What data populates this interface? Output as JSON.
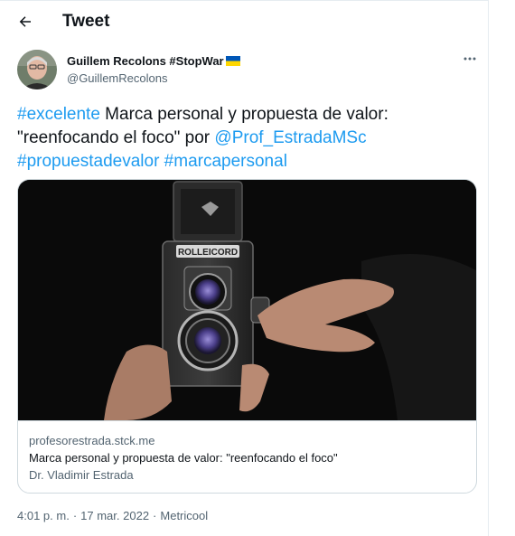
{
  "header": {
    "title": "Tweet"
  },
  "author": {
    "name": "Guillem Recolons #StopWar",
    "handle": "@GuillemRecolons"
  },
  "tweet": {
    "hashtag_1": "#excelente",
    "text_1": " Marca personal y propuesta de valor: \"reenfocando el foco\" por ",
    "mention": "@Prof_EstradaMSc",
    "hashtag_2": "#propuestadevalor",
    "hashtag_3": "#marcapersonal"
  },
  "card": {
    "domain": "profesorestrada.stck.me",
    "title": "Marca personal y propuesta de valor: \"reenfocando el foco\"",
    "description": "Dr. Vladimir Estrada",
    "image_brand_text": "ROLLEICORD"
  },
  "meta": {
    "time": "4:01 p. m.",
    "sep": "·",
    "date": "17 mar. 2022",
    "source": "Metricool"
  },
  "colors": {
    "link": "#1d9bf0",
    "text": "#0f1419",
    "muted": "#536471",
    "border": "#cfd9de",
    "flag_blue": "#0057b7",
    "flag_yellow": "#ffd700"
  },
  "icons": {
    "back": "arrow-left-icon",
    "more": "more-horizontal-icon",
    "flag": "ukraine-flag-icon"
  }
}
